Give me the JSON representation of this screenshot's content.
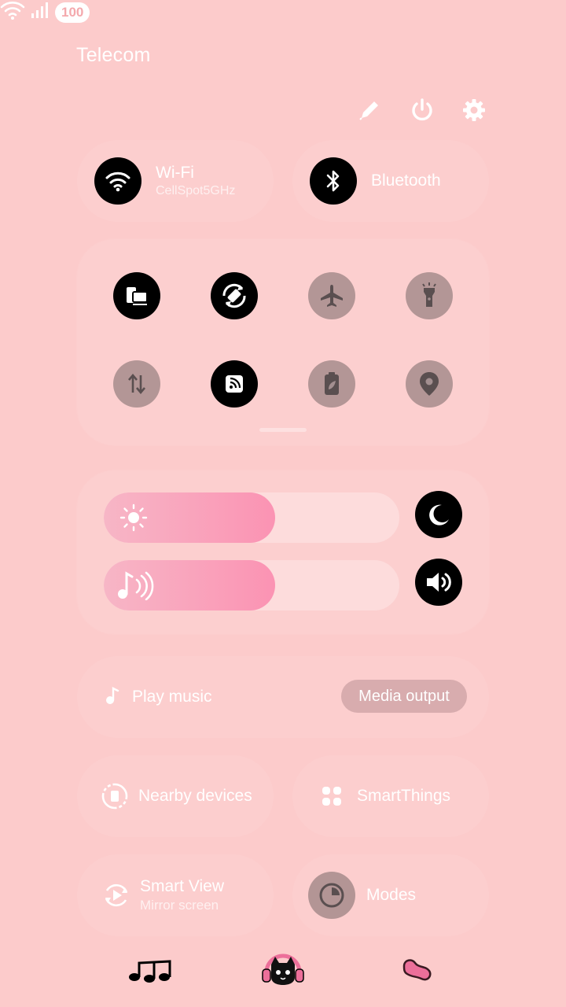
{
  "status_bar": {
    "carrier": "Telecom",
    "battery": "100"
  },
  "tiles": {
    "wifi": {
      "title": "Wi-Fi",
      "subtitle": "CellSpot5GHz",
      "on": true
    },
    "bluetooth": {
      "title": "Bluetooth",
      "on": true
    }
  },
  "quick_toggles": [
    {
      "icon": "device-cast-icon",
      "on": true
    },
    {
      "icon": "auto-rotate-icon",
      "on": true
    },
    {
      "icon": "airplane-icon",
      "on": false
    },
    {
      "icon": "flashlight-icon",
      "on": false
    },
    {
      "icon": "mobile-data-icon",
      "on": false
    },
    {
      "icon": "nfc-icon",
      "on": true
    },
    {
      "icon": "power-saving-icon",
      "on": false
    },
    {
      "icon": "location-icon",
      "on": false
    }
  ],
  "sliders": {
    "brightness": {
      "level_percent": 58
    },
    "volume": {
      "level_percent": 58
    }
  },
  "media": {
    "play_label": "Play music",
    "output_label": "Media output"
  },
  "bottom_tiles": {
    "nearby": {
      "title": "Nearby devices"
    },
    "smartthings": {
      "title": "SmartThings"
    },
    "smartview": {
      "title": "Smart View",
      "subtitle": "Mirror screen"
    },
    "modes": {
      "title": "Modes"
    }
  },
  "colors": {
    "background": "#fccbcb",
    "accent_on": "#000000",
    "slider_fill": "#fb93b3"
  }
}
